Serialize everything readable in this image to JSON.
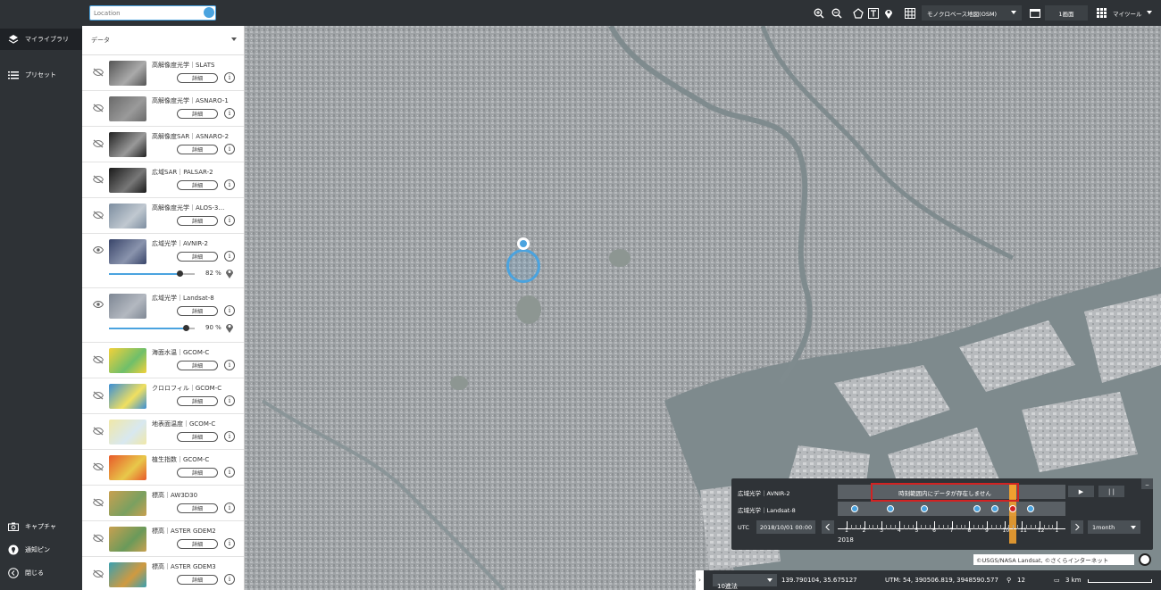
{
  "nav": {
    "items": [
      {
        "label": "マイライブラリ",
        "icon": "layers-icon"
      },
      {
        "label": "プリセット",
        "icon": "list-icon"
      }
    ],
    "bottom": [
      {
        "label": "キャプチャ",
        "icon": "camera-icon"
      },
      {
        "label": "通知ピン",
        "icon": "pin-icon"
      },
      {
        "label": "閉じる",
        "icon": "chevron-left-icon"
      }
    ]
  },
  "search": {
    "placeholder": "Location"
  },
  "toolbar": {
    "basemap": "モノクロベース地図(OSM)",
    "screens": "1画面",
    "mytools": "マイツール"
  },
  "panel": {
    "header": "データ",
    "detail_label": "詳細",
    "info_label": "i",
    "layers": [
      {
        "name": "高解像度光学｜SLATS",
        "visible": false
      },
      {
        "name": "高解像度光学｜ASNARO-1",
        "visible": false
      },
      {
        "name": "高解像度SAR｜ASNARO-2",
        "visible": false
      },
      {
        "name": "広域SAR｜PALSAR-2",
        "visible": false
      },
      {
        "name": "高解像度光学｜ALOS-3…",
        "visible": false
      },
      {
        "name": "広域光学｜AVNIR-2",
        "visible": true,
        "opacity": "82 %",
        "opacity_value": 82
      },
      {
        "name": "広域光学｜Landsat-8",
        "visible": true,
        "opacity": "90 %",
        "opacity_value": 90
      },
      {
        "name": "海面水温｜GCOM-C",
        "visible": false
      },
      {
        "name": "クロロフィル｜GCOM-C",
        "visible": false
      },
      {
        "name": "地表面温度｜GCOM-C",
        "visible": false
      },
      {
        "name": "植生指数｜GCOM-C",
        "visible": false
      },
      {
        "name": "標高｜AW3D30",
        "visible": false
      },
      {
        "name": "標高｜ASTER GDEM2",
        "visible": false
      },
      {
        "name": "標高｜ASTER GDEM3",
        "visible": false
      }
    ]
  },
  "timeline": {
    "row1_label": "広域光学｜AVNIR-2",
    "row2_label": "広域光学｜Landsat-8",
    "no_data": "時刻範囲内にデータが存在しません",
    "play": "▶",
    "pause": "| |",
    "minimize": "_",
    "utc_label": "UTC",
    "datetime": "2018/10/01 00:00",
    "months": [
      "1",
      "2",
      "3",
      "4",
      "5",
      "6",
      "7",
      "8",
      "9",
      "10",
      "11",
      "12",
      "1"
    ],
    "year": "2018",
    "interval": "1month"
  },
  "credit": "©USGS/NASA Landsat, ©さくらインターネット",
  "status": {
    "format": "10進法",
    "latlon": "139.790104, 35.675127",
    "utm": "UTM: 54, 390506.819, 3948590.577",
    "zoom": "12",
    "scale": "3 km"
  },
  "colors": {
    "accent": "#4aa3df",
    "alert": "#d22222",
    "current": "#f0a030"
  }
}
